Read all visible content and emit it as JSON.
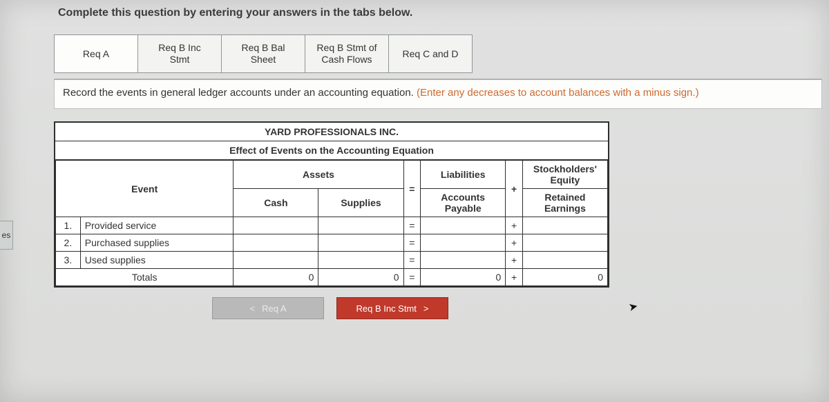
{
  "sidebar": {
    "label": "es"
  },
  "header": {
    "instruction": "Complete this question by entering your answers in the tabs below."
  },
  "tabs": [
    {
      "id": "reqA",
      "label1": "Req A",
      "label2": "",
      "active": true
    },
    {
      "id": "reqBInc",
      "label1": "Req B Inc",
      "label2": "Stmt",
      "active": false
    },
    {
      "id": "reqBBal",
      "label1": "Req B Bal",
      "label2": "Sheet",
      "active": false
    },
    {
      "id": "reqBCash",
      "label1": "Req B Stmt of",
      "label2": "Cash Flows",
      "active": false
    },
    {
      "id": "reqCD",
      "label1": "Req C and D",
      "label2": "",
      "active": false
    }
  ],
  "prompt": {
    "main": "Record the events in general ledger accounts under an accounting equation. ",
    "hint": "(Enter any decreases to account balances with a minus sign.)"
  },
  "worksheet": {
    "company": "YARD PROFESSIONALS INC.",
    "subtitle": "Effect of Events on the Accounting Equation",
    "groups": {
      "event": "Event",
      "assets": "Assets",
      "liab": "Liabilities",
      "equity_l1": "Stockholders'",
      "equity_l2": "Equity"
    },
    "subheads": {
      "cash": "Cash",
      "supplies": "Supplies",
      "ap_l1": "Accounts",
      "ap_l2": "Payable",
      "re_l1": "Retained",
      "re_l2": "Earnings"
    },
    "symbols": {
      "eq": "=",
      "plus": "+"
    },
    "rows": [
      {
        "num": "1.",
        "event": "Provided service",
        "cash": "",
        "supplies": "",
        "ap": "",
        "re": ""
      },
      {
        "num": "2.",
        "event": "Purchased supplies",
        "cash": "",
        "supplies": "",
        "ap": "",
        "re": ""
      },
      {
        "num": "3.",
        "event": "Used supplies",
        "cash": "",
        "supplies": "",
        "ap": "",
        "re": ""
      }
    ],
    "totals": {
      "label": "Totals",
      "cash": "0",
      "supplies": "0",
      "ap": "0",
      "re": "0"
    }
  },
  "nav": {
    "prev": "Req A",
    "next": "Req B Inc Stmt",
    "chev_left": "<",
    "chev_right": ">"
  }
}
